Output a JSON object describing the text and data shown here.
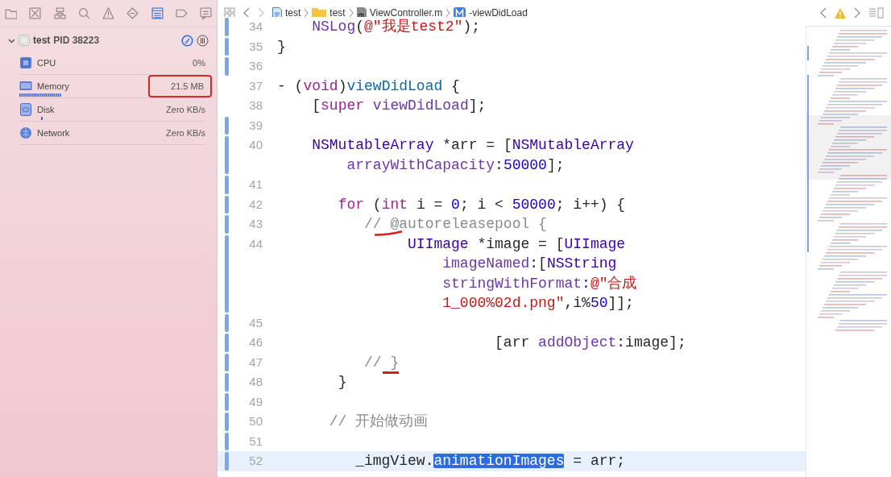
{
  "navigator_tabs": [
    {
      "kind": "folder",
      "selected": false
    },
    {
      "kind": "source-control",
      "selected": false
    },
    {
      "kind": "hierarchy",
      "selected": false
    },
    {
      "kind": "search",
      "selected": false
    },
    {
      "kind": "warning",
      "selected": false
    },
    {
      "kind": "test",
      "selected": false
    },
    {
      "kind": "debug",
      "selected": true
    },
    {
      "kind": "breakpoint",
      "selected": false
    },
    {
      "kind": "report",
      "selected": false
    }
  ],
  "process": {
    "name": "test",
    "pid": "PID 38223",
    "expanded": true
  },
  "gauges": [
    {
      "kind": "cpu",
      "label": "CPU",
      "value": "0%",
      "highlighted": false
    },
    {
      "kind": "memory",
      "label": "Memory",
      "value": "21.5 MB",
      "highlighted": true
    },
    {
      "kind": "disk",
      "label": "Disk",
      "value": "Zero KB/s",
      "highlighted": false
    },
    {
      "kind": "network",
      "label": "Network",
      "value": "Zero KB/s",
      "highlighted": false
    }
  ],
  "breadcrumbs": [
    {
      "kind": "project",
      "label": "test"
    },
    {
      "kind": "folder",
      "label": "test"
    },
    {
      "kind": "file",
      "label": "ViewController.m"
    },
    {
      "kind": "method",
      "label": "-viewDidLoad"
    }
  ],
  "code_lines": [
    {
      "number": "34",
      "changed": true,
      "current": false,
      "rows": [
        [
          {
            "kind": "method",
            "s": "    NSLog"
          },
          {
            "kind": "plain",
            "s": "("
          },
          {
            "kind": "string",
            "s": "@\"我是test2\""
          },
          {
            "kind": "plain",
            "s": ");"
          }
        ]
      ]
    },
    {
      "number": "35",
      "changed": true,
      "current": false,
      "rows": [
        [
          {
            "kind": "plain",
            "s": "}"
          }
        ]
      ]
    },
    {
      "number": "36",
      "changed": true,
      "current": false
    },
    {
      "number": "37",
      "changed": false,
      "current": false,
      "rows": [
        [
          {
            "kind": "plain",
            "s": "- ("
          },
          {
            "kind": "keyword",
            "s": "void"
          },
          {
            "kind": "plain",
            "s": ")"
          },
          {
            "kind": "decl",
            "s": "viewDidLoad"
          },
          {
            "kind": "plain",
            "s": " {"
          }
        ]
      ]
    },
    {
      "number": "38",
      "changed": false,
      "current": false,
      "rows": [
        [
          {
            "kind": "plain",
            "s": "    ["
          },
          {
            "kind": "keyword",
            "s": "super"
          },
          {
            "kind": "method",
            "s": " viewDidLoad"
          },
          {
            "kind": "plain",
            "s": "];"
          }
        ]
      ]
    },
    {
      "number": "39",
      "changed": true,
      "current": false
    },
    {
      "number": "40",
      "changed": true,
      "current": false,
      "rows": [
        [
          {
            "kind": "type",
            "s": "    NSMutableArray"
          },
          {
            "kind": "plain",
            "s": " *arr = ["
          },
          {
            "kind": "type",
            "s": "NSMutableArray"
          }
        ],
        [
          {
            "kind": "method",
            "s": "        arrayWithCapacity"
          },
          {
            "kind": "plain",
            "s": ":"
          },
          {
            "kind": "number",
            "s": "50000"
          },
          {
            "kind": "plain",
            "s": "];"
          }
        ]
      ]
    },
    {
      "number": "41",
      "changed": true,
      "current": false
    },
    {
      "number": "42",
      "changed": true,
      "current": false,
      "rows": [
        [
          {
            "kind": "keyword",
            "s": "       for"
          },
          {
            "kind": "plain",
            "s": " ("
          },
          {
            "kind": "keyword",
            "s": "int"
          },
          {
            "kind": "plain",
            "s": " i = "
          },
          {
            "kind": "number",
            "s": "0"
          },
          {
            "kind": "plain",
            "s": "; i < "
          },
          {
            "kind": "number",
            "s": "50000"
          },
          {
            "kind": "plain",
            "s": "; i++) {"
          }
        ]
      ]
    },
    {
      "number": "43",
      "changed": true,
      "current": false,
      "rows": [
        [
          {
            "kind": "comment",
            "s": "          // @autoreleasepool {"
          }
        ]
      ]
    },
    {
      "number": "44",
      "changed": true,
      "current": false,
      "rows": [
        [
          {
            "kind": "type",
            "s": "               UIImage"
          },
          {
            "kind": "plain",
            "s": " *image = ["
          },
          {
            "kind": "type",
            "s": "UIImage"
          }
        ],
        [
          {
            "kind": "method",
            "s": "                   imageNamed"
          },
          {
            "kind": "plain",
            "s": ":["
          },
          {
            "kind": "type",
            "s": "NSString"
          }
        ],
        [
          {
            "kind": "method",
            "s": "                   stringWithFormat"
          },
          {
            "kind": "plain",
            "s": ":"
          },
          {
            "kind": "string",
            "s": "@\"合成"
          }
        ],
        [
          {
            "kind": "string",
            "s": "                   1_000%02d.png\""
          },
          {
            "kind": "plain",
            "s": ",i%"
          },
          {
            "kind": "number",
            "s": "50"
          },
          {
            "kind": "plain",
            "s": "]];"
          }
        ]
      ]
    },
    {
      "number": "45",
      "changed": true,
      "current": false
    },
    {
      "number": "46",
      "changed": true,
      "current": false,
      "rows": [
        [
          {
            "kind": "plain",
            "s": "                         [arr"
          },
          {
            "kind": "method",
            "s": " addObject"
          },
          {
            "kind": "plain",
            "s": ":image];"
          }
        ]
      ]
    },
    {
      "number": "47",
      "changed": true,
      "current": false,
      "rows": [
        [
          {
            "kind": "comment",
            "s": "          // }"
          }
        ]
      ]
    },
    {
      "number": "48",
      "changed": true,
      "current": false,
      "rows": [
        [
          {
            "kind": "plain",
            "s": "       }"
          }
        ]
      ]
    },
    {
      "number": "49",
      "changed": true,
      "current": false
    },
    {
      "number": "50",
      "changed": true,
      "current": false,
      "rows": [
        [
          {
            "kind": "comment",
            "s": "      // 开始做动画"
          }
        ]
      ]
    },
    {
      "number": "51",
      "changed": true,
      "current": false
    },
    {
      "number": "52",
      "changed": true,
      "current": true,
      "rows": [
        [
          {
            "kind": "plain",
            "s": "         _imgView."
          },
          {
            "kind": "selected",
            "s": "animationImages"
          },
          {
            "kind": "plain",
            "s": " = arr;"
          }
        ]
      ]
    }
  ]
}
